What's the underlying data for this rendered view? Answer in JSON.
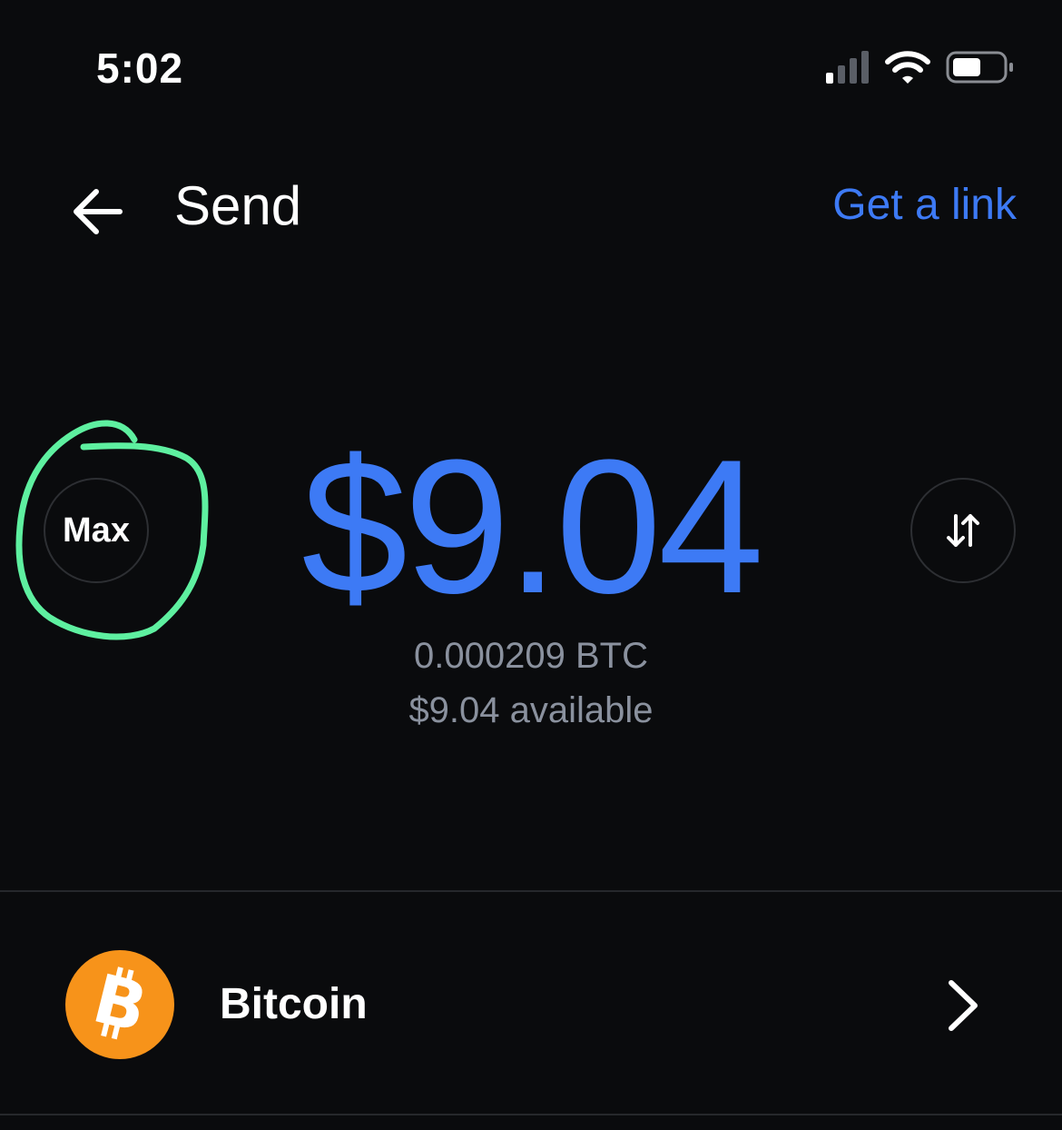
{
  "status_bar": {
    "time": "5:02",
    "icons": [
      "signal-icon",
      "wifi-icon",
      "battery-icon"
    ]
  },
  "header": {
    "back_icon": "arrow-left-icon",
    "title": "Send",
    "get_link_label": "Get a link"
  },
  "amount_entry": {
    "max_label": "Max",
    "fiat_amount": "$9.04",
    "crypto_amount": "0.000209 BTC",
    "available": "$9.04 available",
    "swap_icon": "swap-arrows-icon"
  },
  "asset": {
    "icon": "bitcoin-icon",
    "name": "Bitcoin",
    "chevron_icon": "chevron-right-icon"
  },
  "colors": {
    "background": "#0a0b0d",
    "accent": "#3d7af5",
    "secondary_text": "#8a919e",
    "annotation": "#5ef0a0",
    "bitcoin": "#f7931a"
  }
}
